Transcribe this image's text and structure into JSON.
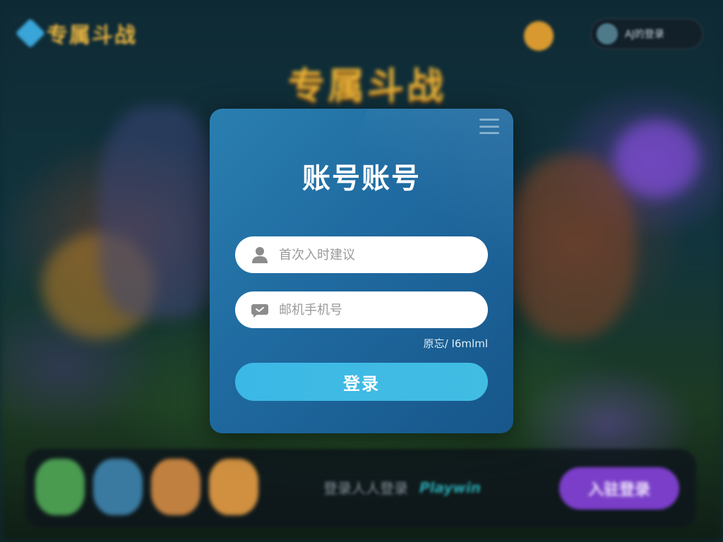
{
  "background": {
    "top_logo_text": "专属斗战",
    "center_logo_text": "专属斗战",
    "user_pill_text": "AJ的登录",
    "bottom_text": "登录人人登录",
    "bottom_accent_text": "Playwin",
    "bottom_button_label": "入驻登录"
  },
  "login": {
    "title": "账号账号",
    "account": {
      "placeholder": "首次入时建议",
      "value": "",
      "icon": "user-icon"
    },
    "phone": {
      "placeholder": "邮机手机号",
      "value": "",
      "icon": "message-icon"
    },
    "hint": "原忘/ I6mlml",
    "submit_label": "登录"
  },
  "colors": {
    "card": "#1f6aa0",
    "button": "#3cb8e6",
    "field": "#ffffff",
    "placeholder": "#9a9a9a",
    "accent_purple": "#7a3ec8"
  }
}
